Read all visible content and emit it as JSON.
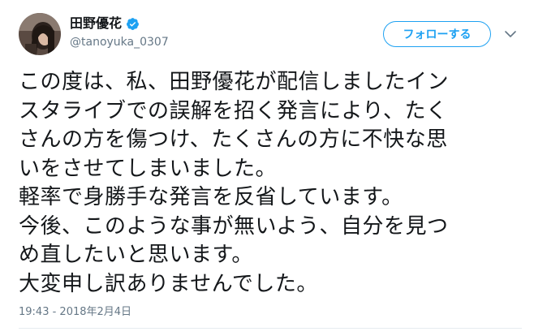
{
  "user": {
    "display_name": "田野優花",
    "handle": "@tanoyuka_0307",
    "verified": true
  },
  "actions": {
    "follow_label": "フォローする"
  },
  "tweet": {
    "lines": [
      "この度は、私、田野優花が配信しましたイン",
      "スタライブでの誤解を招く発言により、たく",
      "さんの方を傷つけ、たくさんの方に不快な思",
      "いをさせてしまいました。",
      "軽率で身勝手な発言を反省しています。",
      "今後、このような事が無いよう、自分を見つ",
      "め直したいと思います。",
      "大変申し訳ありませんでした。"
    ],
    "timestamp": "19:43 - 2018年2月4日"
  },
  "colors": {
    "accent": "#1da1f2",
    "secondary_text": "#657786",
    "divider": "#e6ecf0"
  },
  "icons": {
    "verified": "verified-badge-icon",
    "caret": "chevron-down-icon"
  }
}
